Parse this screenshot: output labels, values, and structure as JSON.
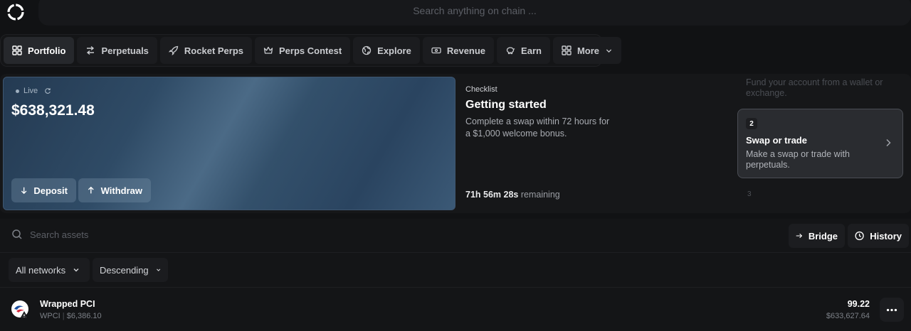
{
  "search": {
    "placeholder": "Search anything on chain ..."
  },
  "nav": {
    "items": [
      {
        "label": "Portfolio",
        "icon": "grid-icon"
      },
      {
        "label": "Perpetuals",
        "icon": "swap-arrows-icon"
      },
      {
        "label": "Rocket Perps",
        "icon": "rocket-icon"
      },
      {
        "label": "Perps Contest",
        "icon": "crown-icon"
      },
      {
        "label": "Explore",
        "icon": "globe-icon"
      },
      {
        "label": "Revenue",
        "icon": "money-icon"
      },
      {
        "label": "Earn",
        "icon": "piggy-bank-icon"
      },
      {
        "label": "More",
        "icon": "grid-icon"
      }
    ]
  },
  "balance_card": {
    "live_label": "Live",
    "balance": "$638,321.48",
    "deposit_label": "Deposit",
    "withdraw_label": "Withdraw"
  },
  "checklist": {
    "label": "Checklist",
    "title": "Getting started",
    "description": "Complete a swap within 72 hours for a $1,000 welcome bonus.",
    "time_left": "71h 56m 28s",
    "remaining_suffix": "remaining",
    "prev_step_desc": "Fund your account from a wallet or exchange.",
    "step": {
      "number": "2",
      "title": "Swap or trade",
      "description": "Make a swap or trade with perpetuals."
    },
    "next_step_number": "3"
  },
  "assets": {
    "search_placeholder": "Search assets",
    "bridge_label": "Bridge",
    "history_label": "History",
    "network_filter": "All networks",
    "sort_filter": "Descending",
    "rows": [
      {
        "name": "Wrapped PCI",
        "symbol": "WPCI",
        "price": "$6,386.10",
        "amount": "99.22",
        "value": "$633,627.64"
      }
    ]
  }
}
